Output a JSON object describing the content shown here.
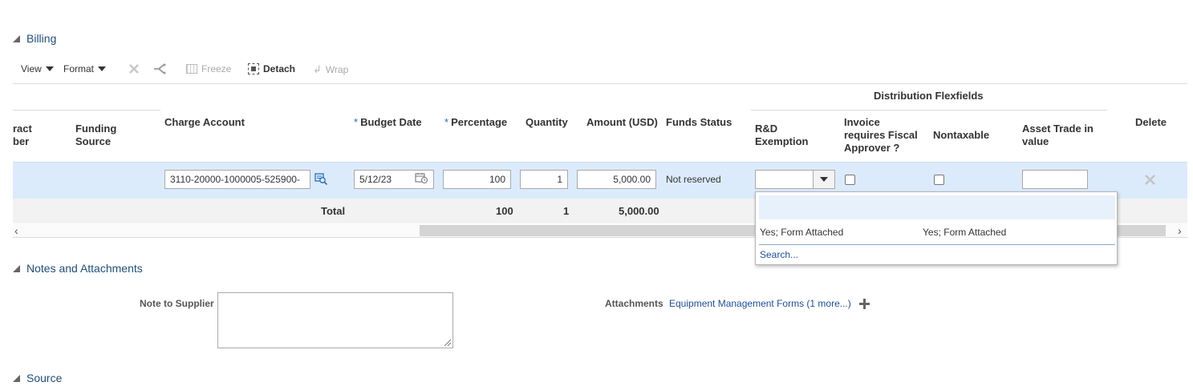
{
  "billing": {
    "section_title": "Billing",
    "toolbar": {
      "view_label": "View",
      "format_label": "Format",
      "freeze_label": "Freeze",
      "detach_label": "Detach",
      "wrap_label": "Wrap"
    },
    "group_header": "Distribution Flexfields",
    "columns": {
      "contract_number_partial": [
        "ract",
        "ber"
      ],
      "funding_source": [
        "Funding",
        "Source"
      ],
      "charge_account": "Charge Account",
      "budget_date": "Budget Date",
      "percentage": "Percentage",
      "quantity": "Quantity",
      "amount": "Amount (USD)",
      "funds_status": "Funds Status",
      "rd_exemption": [
        "R&D",
        "Exemption"
      ],
      "invoice_fiscal": [
        "Invoice",
        "requires Fiscal",
        "Approver ?"
      ],
      "nontaxable": "Nontaxable",
      "asset_trade": [
        "Asset Trade in",
        "value"
      ],
      "delete": "Delete"
    },
    "row": {
      "charge_account": "3110-20000-1000005-525900-",
      "budget_date": "5/12/23",
      "percentage": "100",
      "quantity": "1",
      "amount": "5,000.00",
      "funds_status": "Not reserved",
      "rd_exemption": "",
      "asset_trade": ""
    },
    "totals": {
      "label": "Total",
      "percentage": "100",
      "quantity": "1",
      "amount": "5,000.00"
    },
    "dropdown": {
      "options": [
        {
          "value": "",
          "description": ""
        },
        {
          "value": "Yes; Form Attached",
          "description": "Yes; Form Attached"
        }
      ],
      "search_label": "Search..."
    }
  },
  "notes": {
    "section_title": "Notes and Attachments",
    "note_label": "Note to Supplier",
    "note_value": "",
    "attachments_label": "Attachments",
    "attachments_link": "Equipment Management Forms (1 more...)"
  },
  "source": {
    "section_title": "Source"
  },
  "colors": {
    "selected_row": "#dcebfc",
    "link": "#1f4e9e",
    "totals_row": "#f2f2f2"
  }
}
